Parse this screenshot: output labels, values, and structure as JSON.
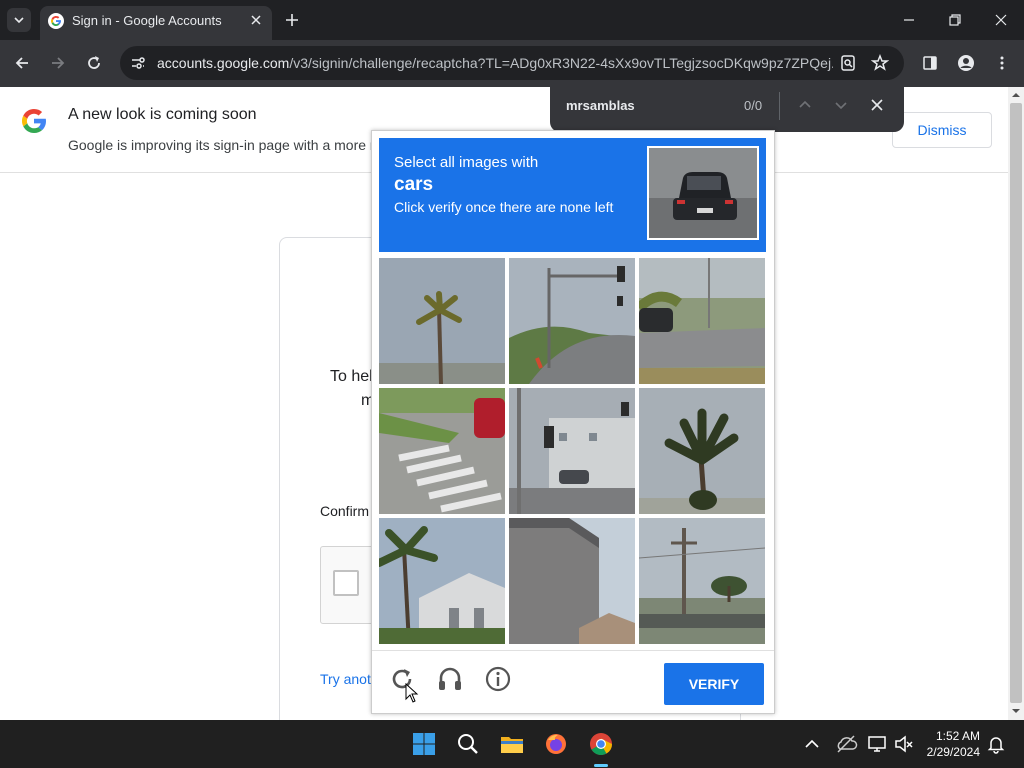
{
  "browser": {
    "tab_title": "Sign in - Google Accounts",
    "url_host": "accounts.google.com",
    "url_path": "/v3/signin/challenge/recaptcha?TL=ADg0xR3N22-4sXx9ovTLTegjzsocDKqw9pz7ZPQej..."
  },
  "find_bar": {
    "query": "mrsamblas",
    "count": "0/0"
  },
  "banner": {
    "title": "A new look is coming soon",
    "text": "Google is improving its sign-in page with a more modern look",
    "dismiss_label": "Dismiss"
  },
  "page": {
    "help_text_partial": "To hel",
    "help_text_partial2": "m",
    "confirm_partial": "Confirm",
    "try_another_partial": "Try anot"
  },
  "captcha": {
    "line1": "Select all images with",
    "target": "cars",
    "line3": "Click verify once there are none left",
    "verify_label": "VERIFY",
    "header_color": "#1a73e8",
    "tiles": [
      "palm-tree",
      "road-with-traffic-light",
      "road-with-car",
      "crosswalk-with-red-car",
      "traffic-lights-street",
      "palm-tree-bush",
      "palm-tree-house",
      "house-wall",
      "utility-pole"
    ]
  },
  "taskbar": {
    "time": "1:52 AM",
    "date": "2/29/2024"
  }
}
